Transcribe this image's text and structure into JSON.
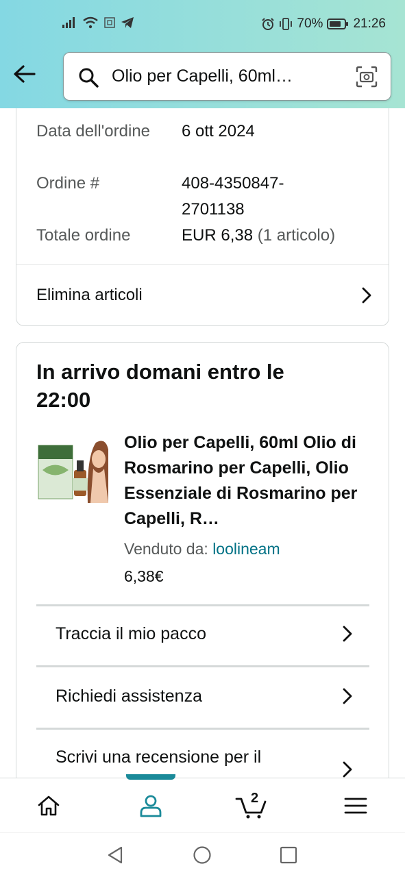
{
  "status_bar": {
    "battery": "70%",
    "time": "21:26"
  },
  "search": {
    "query": "Olio per Capelli, 60ml…"
  },
  "order": {
    "date_label": "Data dell'ordine",
    "date_value": "6 ott 2024",
    "number_label": "Ordine #",
    "number_value": "408-4350847-2701138",
    "total_label": "Totale ordine",
    "total_value": "EUR 6,38",
    "total_items": "(1 articolo)",
    "delete_items": "Elimina articoli"
  },
  "shipment": {
    "arrival_line1": "In arrivo domani entro le",
    "arrival_line2": "22:00",
    "product_title": "Olio per Capelli, 60ml Olio di Rosmarino per Capelli, Olio Essenziale di Rosmarino per Capelli, R…",
    "sold_by_label": "Venduto da:",
    "seller": "loolineam",
    "price": "6,38€",
    "actions": [
      {
        "label": "Traccia il mio pacco"
      },
      {
        "label": "Richiedi assistenza"
      },
      {
        "label": "Scrivi una recensione per il"
      }
    ]
  },
  "bottom_nav": {
    "cart_count": "2"
  },
  "colors": {
    "accent": "#1a8a99",
    "link": "#007185",
    "header_start": "#84d8e3",
    "header_end": "#a6e4d3"
  }
}
